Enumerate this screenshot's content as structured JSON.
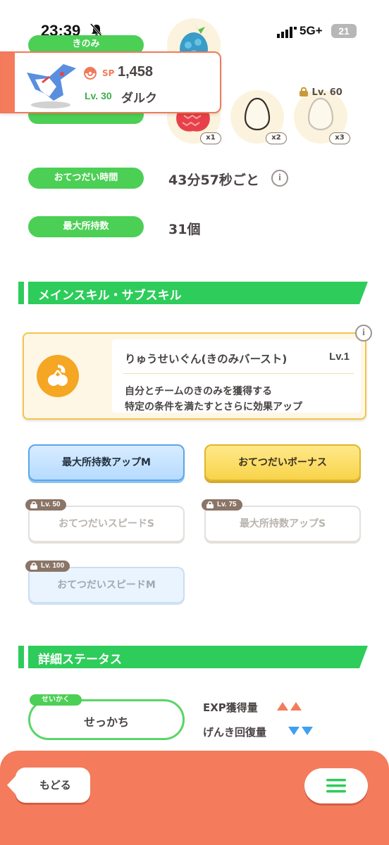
{
  "status_bar": {
    "time": "23:39",
    "network": "5G+",
    "battery": "21"
  },
  "ingredients": {
    "kinomi_label": "きのみ",
    "counts": [
      "x1",
      "x2",
      "x3"
    ],
    "locked_level": "Lv. 60"
  },
  "popup": {
    "sp_label": "SP",
    "sp_value": "1,458",
    "level": "Lv. 30",
    "name": "ダルク"
  },
  "stats": {
    "help_time_label": "おてつだい時間",
    "help_time_value": "43分57秒ごと",
    "max_carry_label": "最大所持数",
    "max_carry_value": "31個"
  },
  "skills": {
    "section_title": "メインスキル・サブスキル",
    "main_skill": {
      "name": "りゅうせいぐん(きのみバースト)",
      "level": "Lv.1",
      "description_line1": "自分とチームのきのみを獲得する",
      "description_line2": "特定の条件を満たすとさらに効果アップ"
    },
    "sub_skills": [
      {
        "label": "最大所持数アップM"
      },
      {
        "label": "おてつだいボーナス"
      },
      {
        "label": "おてつだいスピードS",
        "lock_level": "Lv. 50"
      },
      {
        "label": "最大所持数アップS",
        "lock_level": "Lv. 75"
      },
      {
        "label": "おてつだいスピードM",
        "lock_level": "Lv. 100"
      }
    ]
  },
  "details": {
    "section_title": "詳細ステータス",
    "nature_tag": "せいかく",
    "nature_value": "せっかち",
    "up_effect": "EXP獲得量",
    "down_effect": "げんき回復量",
    "up_color": "#f47b5c",
    "down_color": "#3fa0f0"
  },
  "bottom_nav": {
    "back_label": "もどる",
    "menu_icon": "hamburger-menu-icon"
  }
}
